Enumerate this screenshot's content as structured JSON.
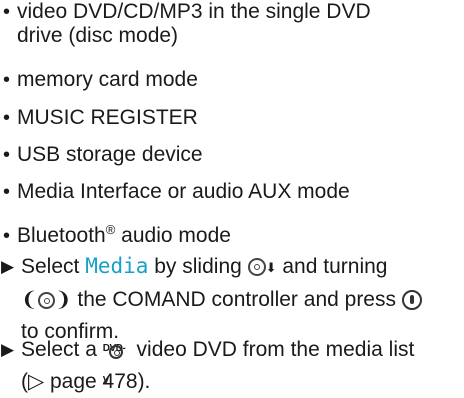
{
  "bullets": [
    {
      "line1": "video DVD/CD/MP3 in the single DVD",
      "line2": "drive (disc mode)"
    },
    {
      "line1": "memory card mode"
    },
    {
      "line1": "MUSIC REGISTER"
    },
    {
      "line1": "USB storage device"
    },
    {
      "line1": "Media Interface or audio AUX mode"
    },
    {
      "line1": "Bluetooth",
      "sup": "®",
      "line1_after": " audio mode"
    }
  ],
  "steps": [
    {
      "prefix": "Select ",
      "highlight": "Media",
      "mid1": " by sliding ",
      "mid2": " and turning",
      "line2_end": " the COMAND controller and press ",
      "line3": "to confirm."
    },
    {
      "prefix": "Select a ",
      "dvd_icon_label": "DVD-V",
      "after_icon": " video DVD from the media list",
      "line2": "(▷ page 478)."
    }
  ],
  "icons": {
    "bullet": "bullet-dot",
    "step_arrow": "triangle-right-icon",
    "slide_down": "controller-slide-down-icon",
    "turn": "controller-turn-icon",
    "press": "controller-press-icon",
    "dvd": "dvd-video-icon"
  },
  "colors": {
    "text": "#1a1a1a",
    "highlight": "#1aa0c8"
  }
}
